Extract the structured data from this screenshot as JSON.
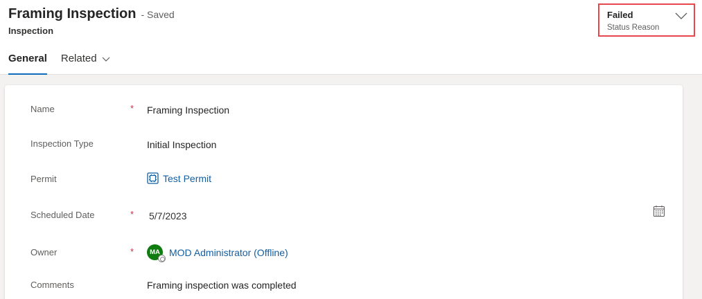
{
  "header": {
    "title": "Framing Inspection",
    "saved_state": "- Saved",
    "entity_type": "Inspection"
  },
  "status": {
    "value": "Failed",
    "label": "Status Reason",
    "icon": "chevron-down-icon",
    "highlight_color": "#e8484d"
  },
  "tabs": [
    {
      "label": "General",
      "active": true
    },
    {
      "label": "Related",
      "icon": "chevron-down-icon"
    }
  ],
  "form": {
    "name": {
      "label": "Name",
      "required_mark": "*",
      "value": "Framing Inspection"
    },
    "inspection_type": {
      "label": "Inspection Type",
      "value": "Initial Inspection"
    },
    "permit": {
      "label": "Permit",
      "value": "Test Permit",
      "icon": "permit-entity-icon"
    },
    "scheduled_date": {
      "label": "Scheduled Date",
      "required_mark": "*",
      "value": "5/7/2023",
      "icon": "calendar-icon"
    },
    "owner": {
      "label": "Owner",
      "required_mark": "*",
      "value": "MOD Administrator (Offline)",
      "avatar_initials": "MA",
      "avatar_color": "#107c10"
    },
    "comments": {
      "label": "Comments",
      "value": "Framing inspection was completed"
    }
  },
  "colors": {
    "accent": "#0f6cbd",
    "link": "#115ea3",
    "required": "#c4314b"
  }
}
